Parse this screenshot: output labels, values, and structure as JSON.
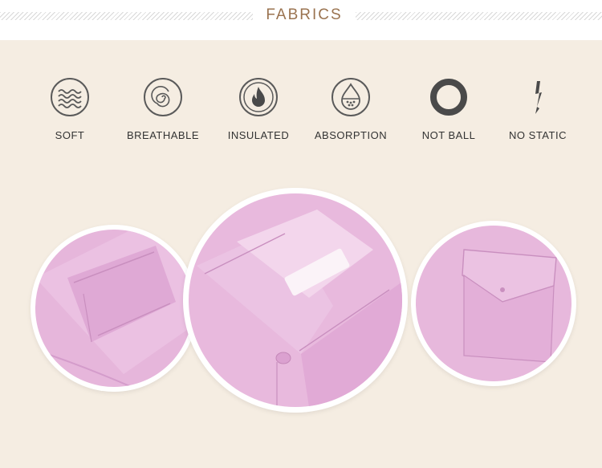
{
  "header": {
    "title": "FABRICS"
  },
  "features": [
    {
      "label": "SOFT",
      "icon": "waves-icon"
    },
    {
      "label": "BREATHABLE",
      "icon": "spiral-icon"
    },
    {
      "label": "INSULATED",
      "icon": "flame-icon"
    },
    {
      "label": "ABSORPTION",
      "icon": "droplet-icon"
    },
    {
      "label": "NOT BALL",
      "icon": "ring-icon"
    },
    {
      "label": "NO STATIC",
      "icon": "lightning-icon"
    }
  ],
  "colors": {
    "background": "#f5ede2",
    "title": "#9a7350",
    "fabric": "#e8b8dd",
    "fabric_shadow": "#d49ccb",
    "icon": "#5a5a5a"
  }
}
